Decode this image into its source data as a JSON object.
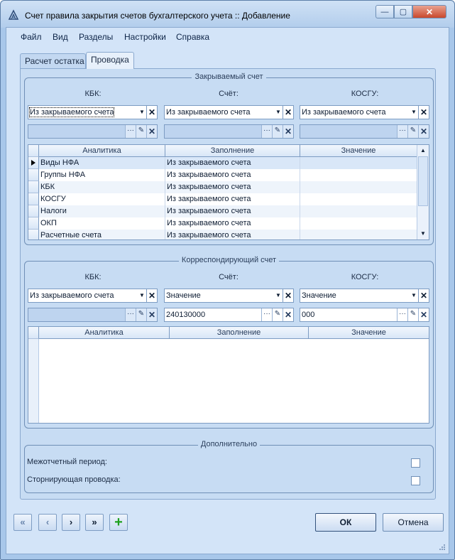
{
  "window": {
    "title": "Счет правила закрытия счетов бухгалтерского учета :: Добавление",
    "min_glyph": "—",
    "max_glyph": "▢",
    "close_glyph": "✕"
  },
  "menu": {
    "items": [
      {
        "label": "Файл"
      },
      {
        "label": "Вид"
      },
      {
        "label": "Разделы"
      },
      {
        "label": "Настройки"
      },
      {
        "label": "Справка"
      }
    ]
  },
  "tabs": [
    {
      "label": "Расчет остатка",
      "active": false
    },
    {
      "label": "Проводка",
      "active": true
    }
  ],
  "closing_account": {
    "title": "Закрываемый счет",
    "columns": {
      "kbk": "КБК:",
      "account": "Счёт:",
      "kosgu": "КОСГУ:"
    },
    "kbk_combo": "Из закрываемого счета",
    "account_combo": "Из закрываемого счета",
    "kosgu_combo": "Из закрываемого счета",
    "kbk_value": "",
    "account_value": "",
    "kosgu_value": "",
    "grid": {
      "headers": [
        "Аналитика",
        "Заполнение",
        "Значение"
      ],
      "rows": [
        {
          "analytic": "Виды НФА",
          "fill": "Из закрываемого счета",
          "value": ""
        },
        {
          "analytic": "Группы НФА",
          "fill": "Из закрываемого счета",
          "value": ""
        },
        {
          "analytic": "КБК",
          "fill": "Из закрываемого счета",
          "value": ""
        },
        {
          "analytic": "КОСГУ",
          "fill": "Из закрываемого счета",
          "value": ""
        },
        {
          "analytic": "Налоги",
          "fill": "Из закрываемого счета",
          "value": ""
        },
        {
          "analytic": "ОКП",
          "fill": "Из закрываемого счета",
          "value": ""
        },
        {
          "analytic": "Расчетные счета",
          "fill": "Из закрываемого счета",
          "value": ""
        }
      ]
    }
  },
  "corresponding_account": {
    "title": "Корреспондирующий счет",
    "columns": {
      "kbk": "КБК:",
      "account": "Счёт:",
      "kosgu": "КОСГУ:"
    },
    "kbk_combo": "Из закрываемого счета",
    "account_combo": "Значение",
    "kosgu_combo": "Значение",
    "kbk_value": "",
    "account_value": "240130000",
    "kosgu_value": "000",
    "grid": {
      "headers": [
        "Аналитика",
        "Заполнение",
        "Значение"
      ],
      "rows": []
    }
  },
  "additional": {
    "title": "Дополнительно",
    "interaccount_period": {
      "label": "Межотчетный период:",
      "checked": false
    },
    "reversing_entry": {
      "label": "Сторнирующая проводка:",
      "checked": false
    }
  },
  "footer": {
    "first_glyph": "«",
    "prev_glyph": "‹",
    "next_glyph": "›",
    "last_glyph": "»",
    "add_glyph": "+",
    "ok_label": "ОК",
    "cancel_label": "Отмена"
  },
  "icons": {
    "dropdown": "▼",
    "clear": "✕",
    "ellipsis": "···",
    "edit": "✎",
    "scroll_up": "▲",
    "scroll_down": "▼"
  }
}
